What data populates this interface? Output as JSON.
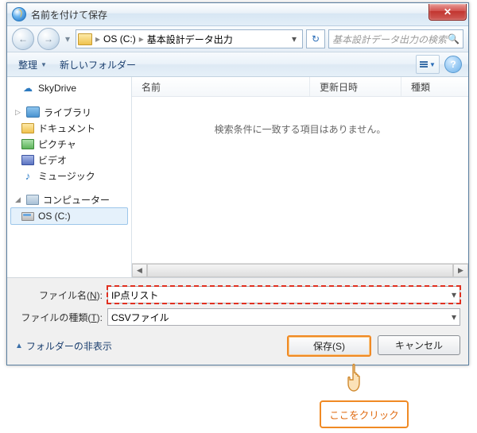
{
  "title": "名前を付けて保存",
  "address": {
    "drive": "OS (C:)",
    "folder": "基本設計データ出力"
  },
  "search_placeholder": "基本設計データ出力の検索",
  "toolbar": {
    "organize": "整理",
    "new_folder": "新しいフォルダー"
  },
  "tree": {
    "skydrive": "SkyDrive",
    "libraries": "ライブラリ",
    "documents": "ドキュメント",
    "pictures": "ピクチャ",
    "videos": "ビデオ",
    "music": "ミュージック",
    "computer": "コンピューター",
    "drive": "OS (C:)"
  },
  "columns": {
    "name": "名前",
    "modified": "更新日時",
    "type": "種類"
  },
  "empty_message": "検索条件に一致する項目はありません。",
  "fields": {
    "filename_label_pre": "ファイル名(",
    "filename_label_u": "N",
    "filename_label_post": "):",
    "filename_value": "IP点リスト",
    "filetype_label_pre": "ファイルの種類(",
    "filetype_label_u": "T",
    "filetype_label_post": "):",
    "filetype_value": "CSVファイル"
  },
  "hide_folders": "フォルダーの非表示",
  "buttons": {
    "save": "保存(S)",
    "cancel": "キャンセル"
  },
  "callout": "ここをクリック"
}
